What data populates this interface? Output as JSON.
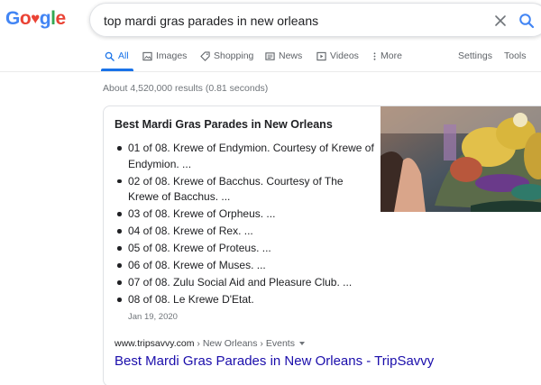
{
  "logo": {
    "text": "Google",
    "colors": [
      "#4285F4",
      "#EA4335",
      "#FBBC05",
      "#4285F4",
      "#34A853",
      "#EA4335"
    ]
  },
  "search": {
    "query": "top mardi gras parades in new orleans",
    "clear_icon": "close-icon",
    "search_icon": "search-icon"
  },
  "tabs": [
    {
      "label": "All",
      "icon": "search-icon",
      "active": true
    },
    {
      "label": "Images",
      "icon": "image-icon",
      "active": false
    },
    {
      "label": "Shopping",
      "icon": "tag-icon",
      "active": false
    },
    {
      "label": "News",
      "icon": "news-icon",
      "active": false
    },
    {
      "label": "Videos",
      "icon": "play-icon",
      "active": false
    },
    {
      "label": "More",
      "icon": "more-vert-icon",
      "active": false
    }
  ],
  "settings_label": "Settings",
  "tools_label": "Tools",
  "result_stats": "About 4,520,000 results (0.81 seconds)",
  "snippet": {
    "title": "Best Mardi Gras Parades in New Orleans",
    "items": [
      "01 of 08. Krewe of Endymion. Courtesy of Krewe of Endymion. ...",
      "02 of 08. Krewe of Bacchus. Courtesy of The Krewe of Bacchus. ...",
      "03 of 08. Krewe of Orpheus. ...",
      "04 of 08. Krewe of Rex. ...",
      "05 of 08. Krewe of Proteus. ...",
      "06 of 08. Krewe of Muses. ...",
      "07 of 08. Zulu Social Aid and Pleasure Club. ...",
      "08 of 08. Le Krewe D'Etat."
    ],
    "date": "Jan 19, 2020",
    "cite_domain": "www.tripsavvy.com",
    "cite_path": " › New Orleans › Events",
    "link_title": "Best Mardi Gras Parades in New Orleans - TripSavvy"
  },
  "colors": {
    "accent": "#1a73e8",
    "link": "#1a0dab",
    "muted": "#70757a"
  }
}
